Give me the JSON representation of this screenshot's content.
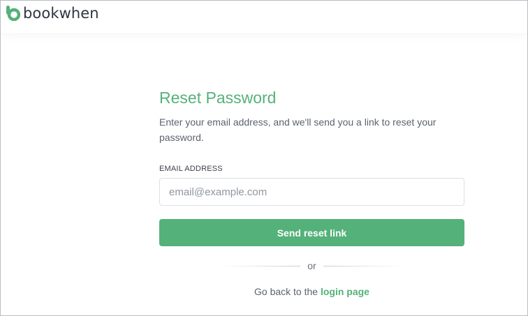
{
  "brand": {
    "name": "bookwhen",
    "logo_icon": "bookwhen-logo-icon",
    "color": "#55b17a"
  },
  "form": {
    "title": "Reset Password",
    "description": "Enter your email address, and we'll send you a link to reset your password.",
    "email_label": "EMAIL ADDRESS",
    "email_placeholder": "email@example.com",
    "email_value": "",
    "submit_label": "Send reset link"
  },
  "divider": {
    "text": "or"
  },
  "footer": {
    "prefix": "Go back to the",
    "link_label": "login page"
  }
}
